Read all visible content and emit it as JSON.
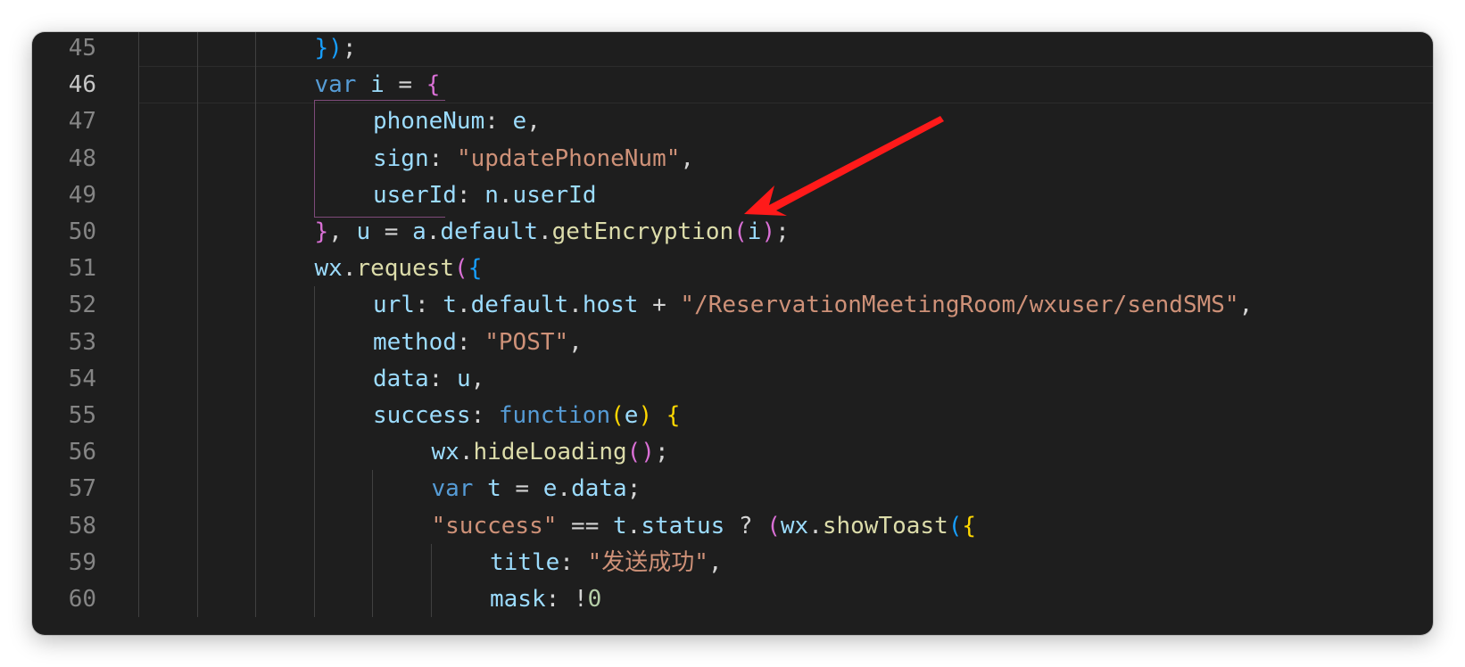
{
  "editor": {
    "active_line_index": 1,
    "lines": [
      {
        "number": "45",
        "indent": 3,
        "tokens": [
          {
            "t": "})",
            "c": "b3"
          },
          {
            "t": ";",
            "c": "p"
          }
        ]
      },
      {
        "number": "46",
        "indent": 3,
        "tokens": [
          {
            "t": "var",
            "c": "kw"
          },
          {
            "t": " ",
            "c": "p"
          },
          {
            "t": "i",
            "c": "var"
          },
          {
            "t": " = ",
            "c": "p"
          },
          {
            "t": "{",
            "c": "b2"
          }
        ]
      },
      {
        "number": "47",
        "indent": 4,
        "tokens": [
          {
            "t": "phoneNum",
            "c": "var"
          },
          {
            "t": ": ",
            "c": "p"
          },
          {
            "t": "e",
            "c": "var"
          },
          {
            "t": ",",
            "c": "p"
          }
        ]
      },
      {
        "number": "48",
        "indent": 4,
        "tokens": [
          {
            "t": "sign",
            "c": "var"
          },
          {
            "t": ": ",
            "c": "p"
          },
          {
            "t": "\"updatePhoneNum\"",
            "c": "str"
          },
          {
            "t": ",",
            "c": "p"
          }
        ]
      },
      {
        "number": "49",
        "indent": 4,
        "tokens": [
          {
            "t": "userId",
            "c": "var"
          },
          {
            "t": ": ",
            "c": "p"
          },
          {
            "t": "n",
            "c": "var"
          },
          {
            "t": ".",
            "c": "p"
          },
          {
            "t": "userId",
            "c": "var"
          }
        ]
      },
      {
        "number": "50",
        "indent": 3,
        "tokens": [
          {
            "t": "}",
            "c": "b2"
          },
          {
            "t": ", ",
            "c": "p"
          },
          {
            "t": "u",
            "c": "var"
          },
          {
            "t": " = ",
            "c": "p"
          },
          {
            "t": "a",
            "c": "var"
          },
          {
            "t": ".",
            "c": "p"
          },
          {
            "t": "default",
            "c": "var"
          },
          {
            "t": ".",
            "c": "p"
          },
          {
            "t": "getEncryption",
            "c": "fn"
          },
          {
            "t": "(",
            "c": "b2"
          },
          {
            "t": "i",
            "c": "var"
          },
          {
            "t": ")",
            "c": "b2"
          },
          {
            "t": ";",
            "c": "p"
          }
        ]
      },
      {
        "number": "51",
        "indent": 3,
        "tokens": [
          {
            "t": "wx",
            "c": "var"
          },
          {
            "t": ".",
            "c": "p"
          },
          {
            "t": "request",
            "c": "fn"
          },
          {
            "t": "(",
            "c": "b2"
          },
          {
            "t": "{",
            "c": "b3"
          }
        ]
      },
      {
        "number": "52",
        "indent": 4,
        "tokens": [
          {
            "t": "url",
            "c": "var"
          },
          {
            "t": ": ",
            "c": "p"
          },
          {
            "t": "t",
            "c": "var"
          },
          {
            "t": ".",
            "c": "p"
          },
          {
            "t": "default",
            "c": "var"
          },
          {
            "t": ".",
            "c": "p"
          },
          {
            "t": "host",
            "c": "var"
          },
          {
            "t": " + ",
            "c": "p"
          },
          {
            "t": "\"/ReservationMeetingRoom/wxuser/sendSMS\"",
            "c": "str"
          },
          {
            "t": ",",
            "c": "p"
          }
        ]
      },
      {
        "number": "53",
        "indent": 4,
        "tokens": [
          {
            "t": "method",
            "c": "var"
          },
          {
            "t": ": ",
            "c": "p"
          },
          {
            "t": "\"POST\"",
            "c": "str"
          },
          {
            "t": ",",
            "c": "p"
          }
        ]
      },
      {
        "number": "54",
        "indent": 4,
        "tokens": [
          {
            "t": "data",
            "c": "var"
          },
          {
            "t": ": ",
            "c": "p"
          },
          {
            "t": "u",
            "c": "var"
          },
          {
            "t": ",",
            "c": "p"
          }
        ]
      },
      {
        "number": "55",
        "indent": 4,
        "tokens": [
          {
            "t": "success",
            "c": "var"
          },
          {
            "t": ": ",
            "c": "p"
          },
          {
            "t": "function",
            "c": "kw"
          },
          {
            "t": "(",
            "c": "b1"
          },
          {
            "t": "e",
            "c": "var"
          },
          {
            "t": ")",
            "c": "b1"
          },
          {
            "t": " ",
            "c": "p"
          },
          {
            "t": "{",
            "c": "b1"
          }
        ]
      },
      {
        "number": "56",
        "indent": 5,
        "tokens": [
          {
            "t": "wx",
            "c": "var"
          },
          {
            "t": ".",
            "c": "p"
          },
          {
            "t": "hideLoading",
            "c": "fn"
          },
          {
            "t": "()",
            "c": "b2"
          },
          {
            "t": ";",
            "c": "p"
          }
        ]
      },
      {
        "number": "57",
        "indent": 5,
        "tokens": [
          {
            "t": "var",
            "c": "kw"
          },
          {
            "t": " ",
            "c": "p"
          },
          {
            "t": "t",
            "c": "var"
          },
          {
            "t": " = ",
            "c": "p"
          },
          {
            "t": "e",
            "c": "var"
          },
          {
            "t": ".",
            "c": "p"
          },
          {
            "t": "data",
            "c": "var"
          },
          {
            "t": ";",
            "c": "p"
          }
        ]
      },
      {
        "number": "58",
        "indent": 5,
        "tokens": [
          {
            "t": "\"success\"",
            "c": "str"
          },
          {
            "t": " == ",
            "c": "p"
          },
          {
            "t": "t",
            "c": "var"
          },
          {
            "t": ".",
            "c": "p"
          },
          {
            "t": "status",
            "c": "var"
          },
          {
            "t": " ? ",
            "c": "p"
          },
          {
            "t": "(",
            "c": "b2"
          },
          {
            "t": "wx",
            "c": "var"
          },
          {
            "t": ".",
            "c": "p"
          },
          {
            "t": "showToast",
            "c": "fn"
          },
          {
            "t": "(",
            "c": "b3"
          },
          {
            "t": "{",
            "c": "b1"
          }
        ]
      },
      {
        "number": "59",
        "indent": 6,
        "tokens": [
          {
            "t": "title",
            "c": "var"
          },
          {
            "t": ": ",
            "c": "p"
          },
          {
            "t": "\"发送成功\"",
            "c": "str"
          },
          {
            "t": ",",
            "c": "p"
          }
        ]
      },
      {
        "number": "60",
        "indent": 6,
        "tokens": [
          {
            "t": "mask",
            "c": "var"
          },
          {
            "t": ": ",
            "c": "p"
          },
          {
            "t": "!",
            "c": "p"
          },
          {
            "t": "0",
            "c": "num"
          }
        ]
      }
    ]
  },
  "annotation": {
    "arrow_color": "#ff1a1a"
  }
}
